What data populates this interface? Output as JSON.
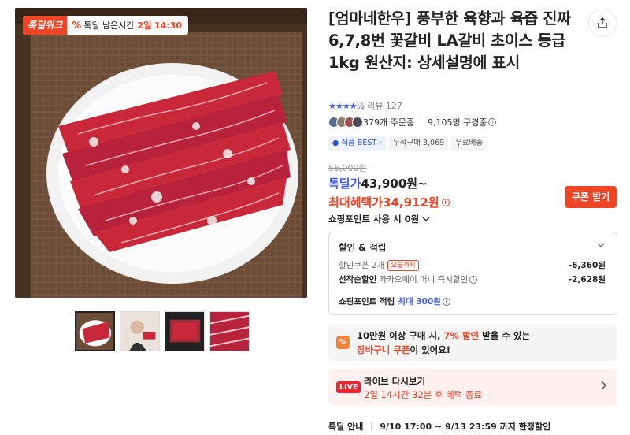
{
  "deal_badge": {
    "logo": "톡딜위크",
    "pct_icon": "%",
    "label": "톡딜 남은시간",
    "time": "2일 14:30"
  },
  "product": {
    "title": "[엄마네한우] 풍부한 육향과 육즙 진짜 6,7,8번 꽃갈비 LA갈비 초이스 등급 1kg 원산지: 상세설명에 표시"
  },
  "rating": {
    "stars": "★★★★½",
    "review_label": "리뷰 127"
  },
  "buyers": {
    "orders": "379개 주문중",
    "subscribers": "9,105명 구경중",
    "avatar_colors": [
      "#5a6a8a",
      "#8a7a6a",
      "#a05050",
      "#4a4a5a"
    ]
  },
  "tags": {
    "best": "식품 BEST",
    "cumulative": "누적구매 3,069",
    "shipping": "무료배송"
  },
  "price": {
    "original": "56,000원",
    "deal_label": "톡딜가",
    "deal_value": "43,900원~",
    "max_label": "최대혜택가",
    "max_value": "34,912원",
    "coupon_button": "쿠폰 받기",
    "point_use": "쇼핑포인트 사용 시 0원"
  },
  "discount_box": {
    "title": "할인 & 적립",
    "coupon_label": "할인쿠폰 2개",
    "coupon_chip": "오늘까지",
    "coupon_value": "-6,360원",
    "first_label": "선착순할인",
    "first_sub": "카카오페이 머니 즉시할인",
    "first_value": "-2,628원",
    "points_label": "쇼핑포인트 적립",
    "points_value": "최대 300원"
  },
  "promo": {
    "line1_pre": "10만원 이상 구매 시, ",
    "line1_hl": "7% 할인",
    "line1_post": " 받을 수 있는",
    "line2_hl": "장바구니 쿠폰",
    "line2_post": "이 있어요!"
  },
  "live": {
    "badge": "LIVE",
    "title": "라이브 다시보기",
    "sub": "2일 14시간 32분 후 혜택 종료"
  },
  "deal_info": {
    "label": "톡딜 안내",
    "period": "9/10 17:00 ~ 9/13 23:59 까지 한정할인"
  },
  "colors": {
    "accent_red": "#f04426",
    "accent_blue": "#3d5af1",
    "live_red": "#f0242f"
  },
  "icons": {
    "share": "share-icon",
    "info": "info-icon",
    "chevron_down": "chevron-down-icon",
    "chevron_right": "chevron-right-icon"
  }
}
